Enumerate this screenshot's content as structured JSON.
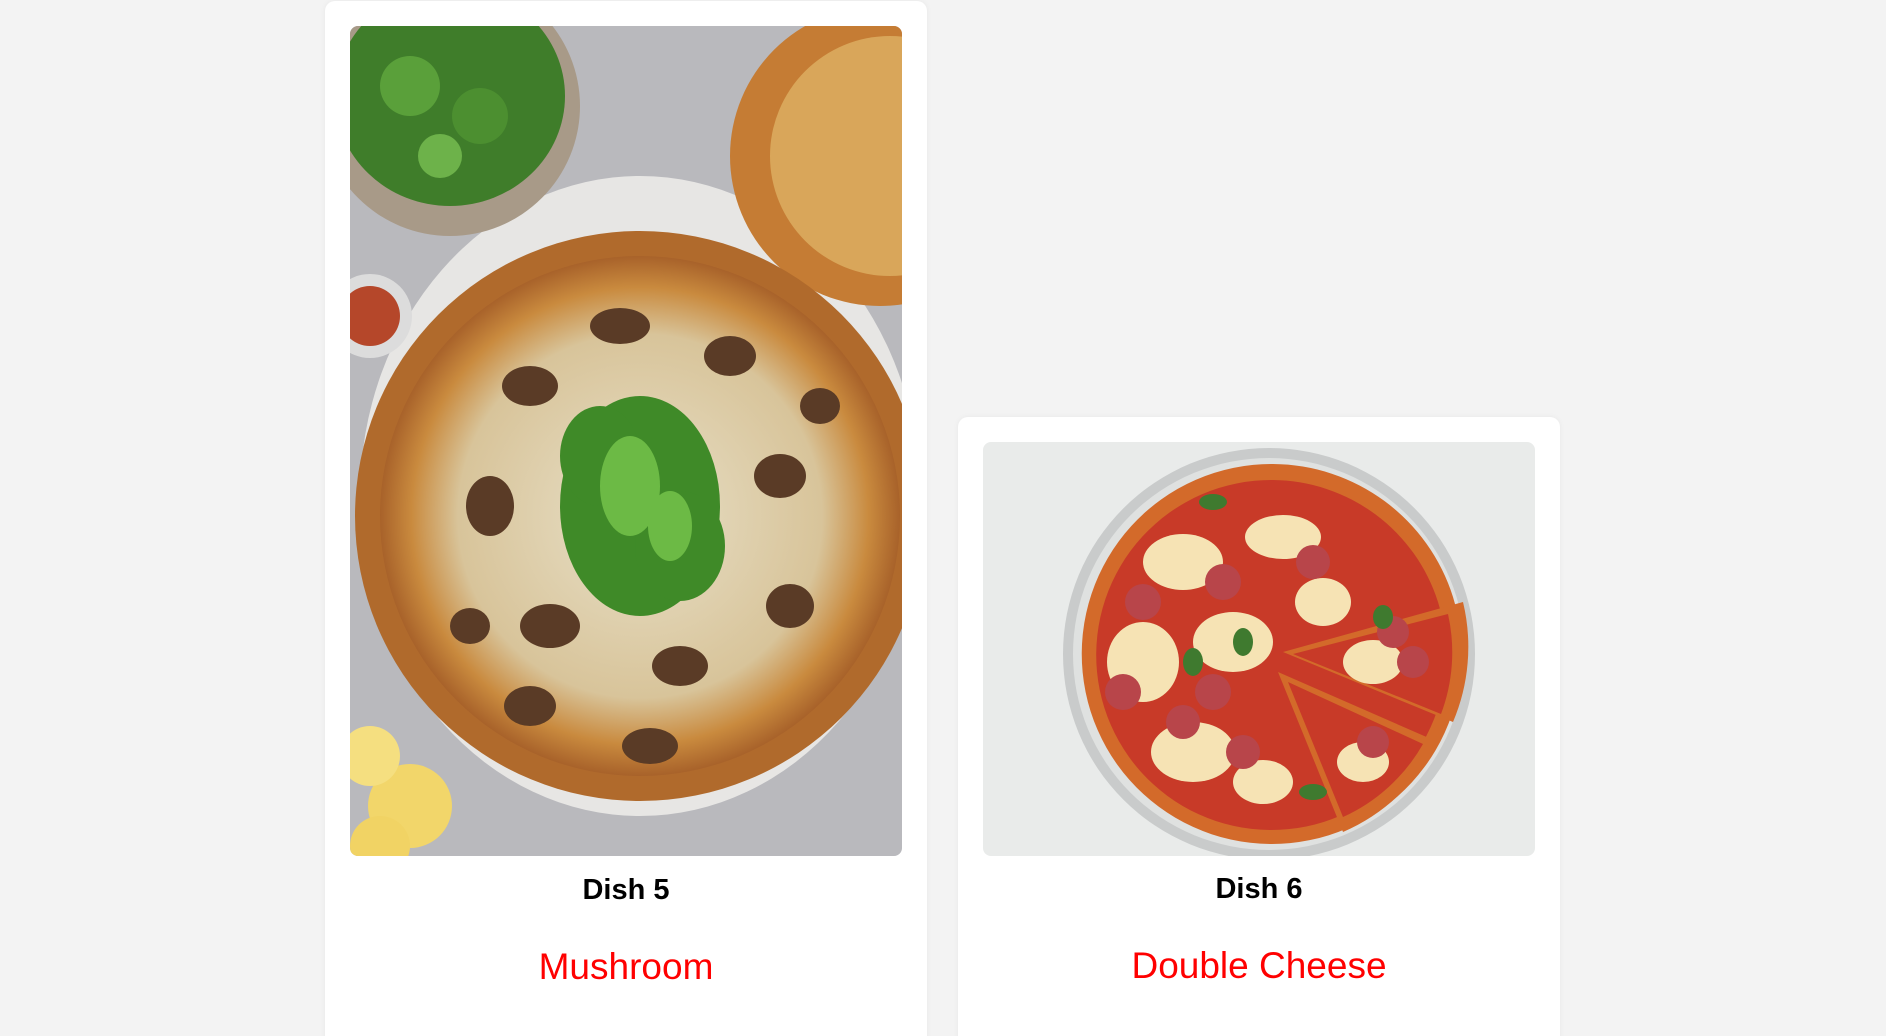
{
  "dishes": [
    {
      "title": "Dish 5",
      "name": "Mushroom",
      "image": "mushroom-pizza-photo"
    },
    {
      "title": "Dish 6",
      "name": "Double Cheese",
      "image": "pepperoni-cheese-pizza-photo"
    }
  ],
  "colors": {
    "page_background": "#f3f3f3",
    "card_background": "#ffffff",
    "dish_name": "#ff0000",
    "dish_title": "#000000"
  }
}
